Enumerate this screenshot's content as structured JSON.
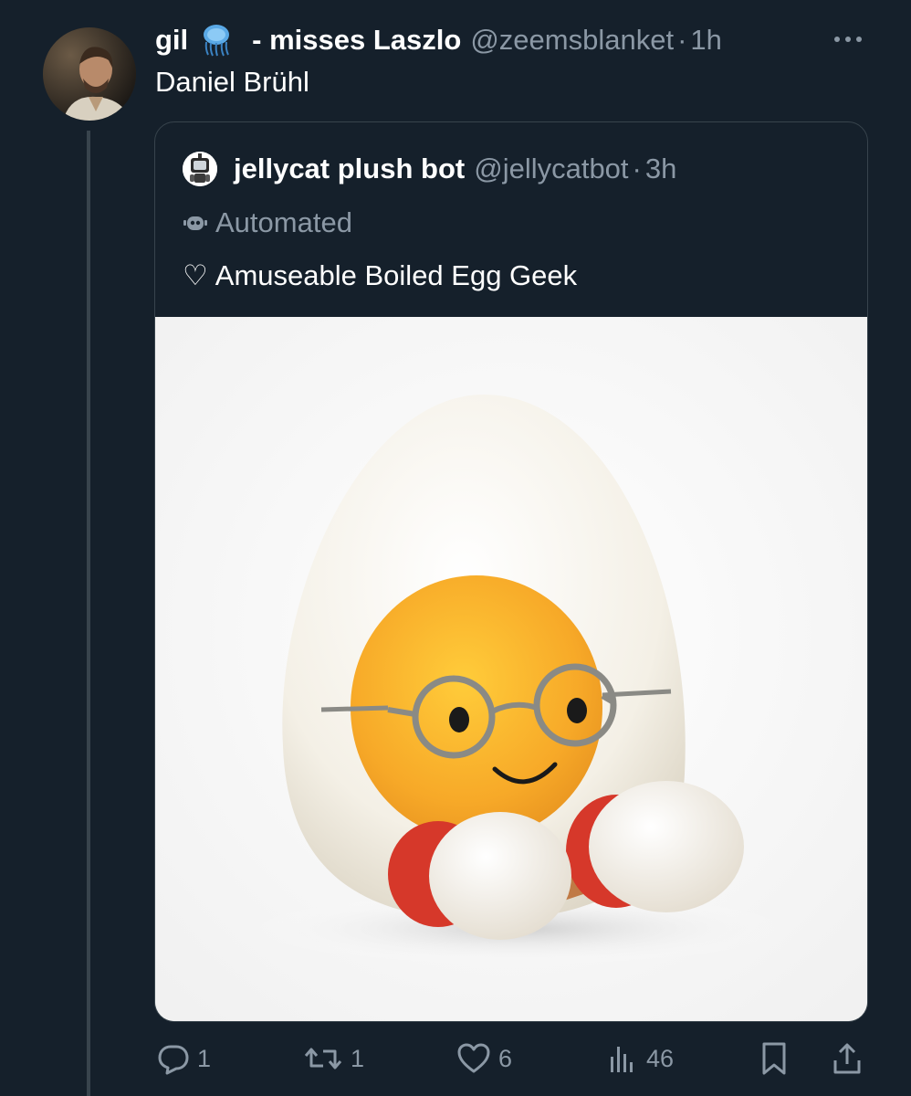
{
  "tweet": {
    "display_name": "gil",
    "display_name_suffix": "- misses Laszlo",
    "handle": "@zeemsblanket",
    "separator": "·",
    "time": "1h",
    "text": "Daniel Brühl",
    "avatar_icon": "user-photo-avatar",
    "emoji_icon": "jellyfish-emoji"
  },
  "quote": {
    "display_name": "jellycat plush bot",
    "handle": "@jellycatbot",
    "separator": "·",
    "time": "3h",
    "automated_label": "Automated",
    "text": "Amuseable Boiled Egg Geek",
    "heart_glyph": "♡",
    "image_alt": "boiled-egg-plush-photo"
  },
  "actions": {
    "replies": "1",
    "reposts": "1",
    "likes": "6",
    "views": "46"
  },
  "colors": {
    "background": "#15202b",
    "text": "#ffffff",
    "muted": "#8b98a5",
    "border": "#38444d"
  }
}
